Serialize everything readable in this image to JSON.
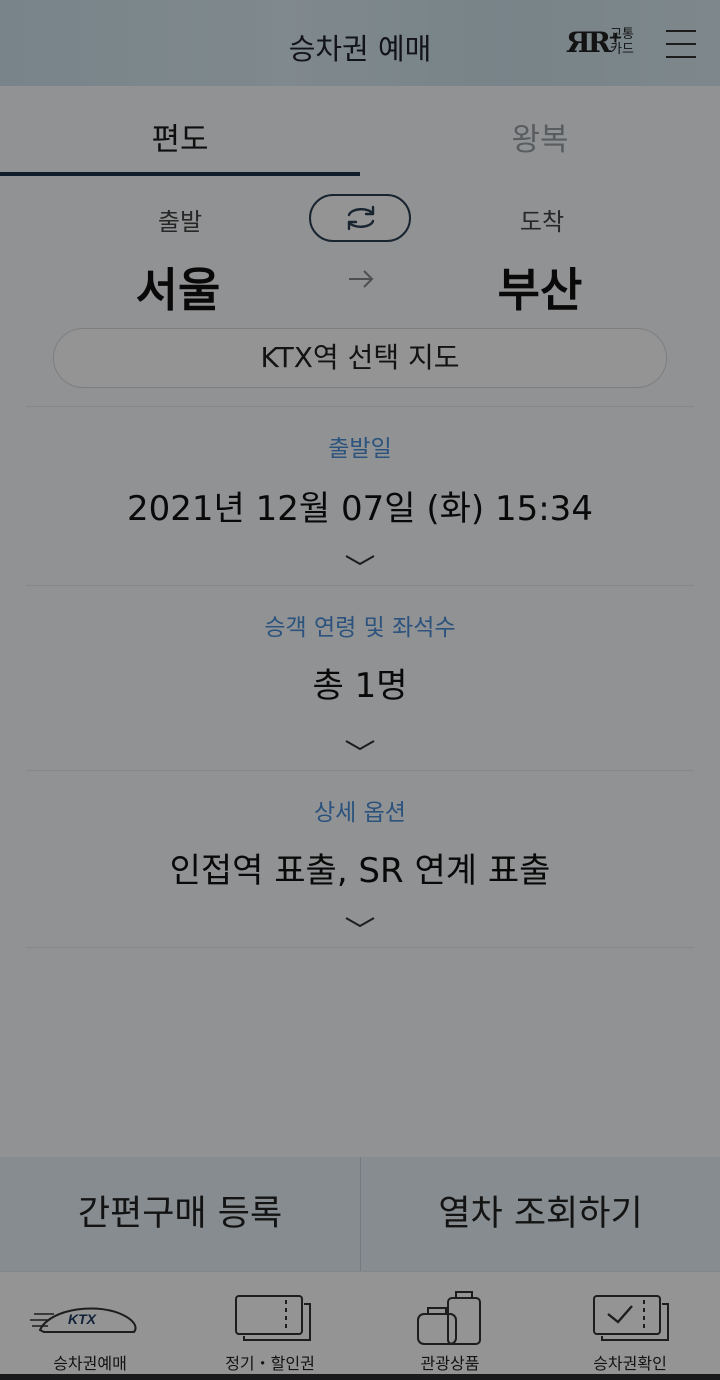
{
  "header": {
    "title": "승차권 예매",
    "card_logo_text_line1": "교통",
    "card_logo_text_line2": "카드"
  },
  "tabs": [
    {
      "label": "편도",
      "selected": true
    },
    {
      "label": "왕복",
      "selected": false
    }
  ],
  "route": {
    "departure_label": "출발",
    "arrival_label": "도착",
    "departure_station": "서울",
    "arrival_station": "부산",
    "map_button": "KTX역 선택 지도"
  },
  "sections": {
    "date": {
      "label": "출발일",
      "value": "2021년 12월 07일 (화) 15:34"
    },
    "passengers": {
      "label": "승객 연령 및 좌석수",
      "value": "총 1명"
    },
    "options": {
      "label": "상세 옵션",
      "value": "인접역 표출, SR 연계 표출"
    }
  },
  "actions": {
    "quick_purchase": "간편구매 등록",
    "search_trains": "열차 조회하기"
  },
  "bottom_nav": [
    {
      "label": "승차권예매",
      "icon": "ktx-train-icon",
      "logo_text": "KTX"
    },
    {
      "label": "정기・할인권",
      "icon": "pass-ticket-icon"
    },
    {
      "label": "관광상품",
      "icon": "luggage-icon"
    },
    {
      "label": "승차권확인",
      "icon": "ticket-check-icon"
    }
  ],
  "colors": {
    "accent_blue": "#4a8fd9",
    "navy": "#20344a",
    "header_bg": "#cfe4ee",
    "dim_overlay": "rgba(0,0,0,0.42)"
  }
}
